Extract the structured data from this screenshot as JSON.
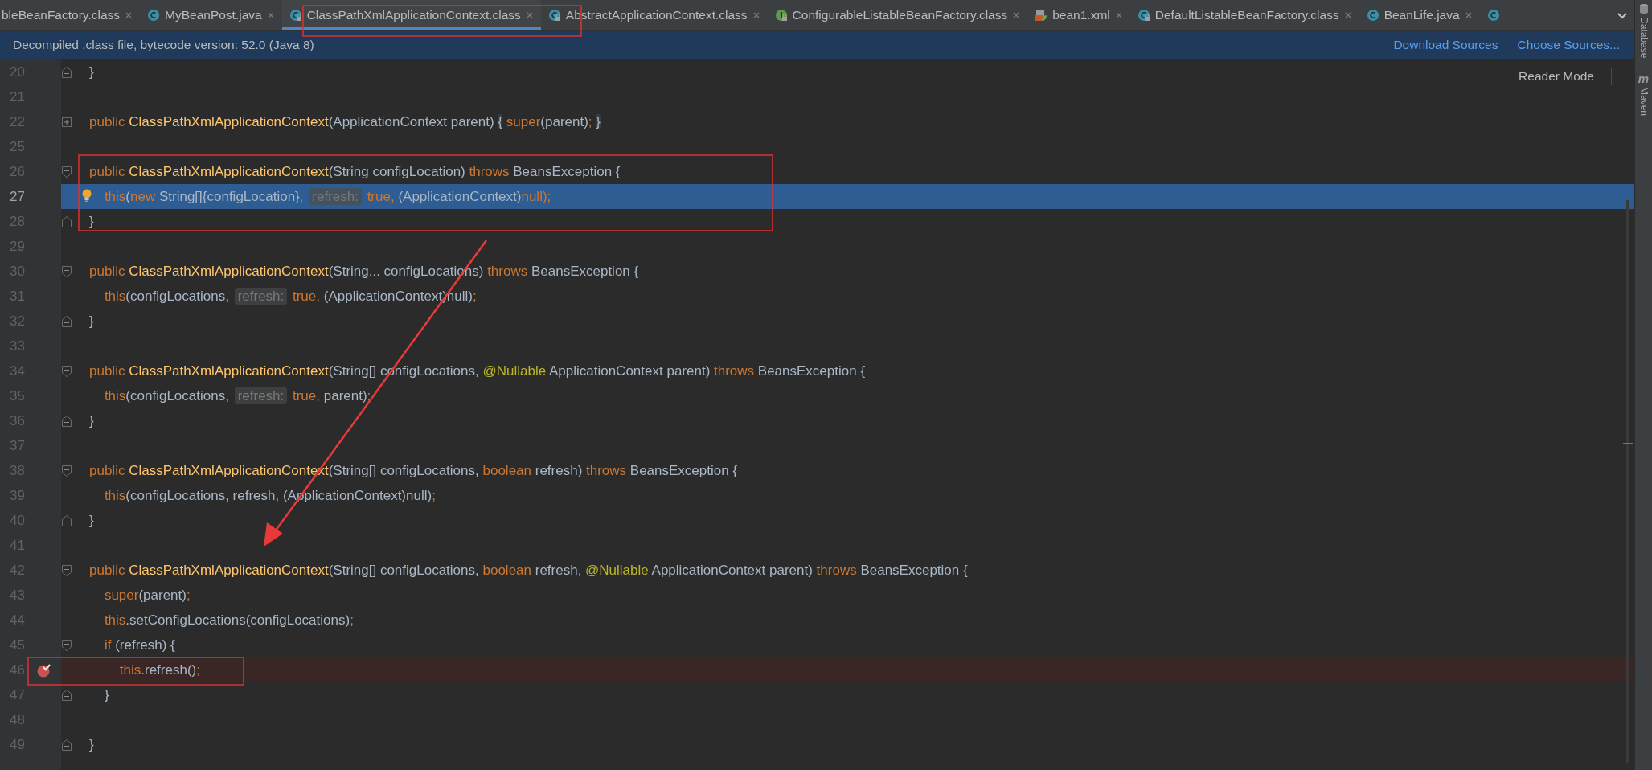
{
  "tabs": [
    {
      "label": "bleBeanFactory.class",
      "kind": "cut",
      "selected": false
    },
    {
      "label": "MyBeanPost.java",
      "kind": "class",
      "selected": false
    },
    {
      "label": "ClassPathXmlApplicationContext.class",
      "kind": "locked-class",
      "selected": true
    },
    {
      "label": "AbstractApplicationContext.class",
      "kind": "locked-class",
      "selected": false
    },
    {
      "label": "ConfigurableListableBeanFactory.class",
      "kind": "locked-interface",
      "selected": false
    },
    {
      "label": "bean1.xml",
      "kind": "xml",
      "selected": false
    },
    {
      "label": "DefaultListableBeanFactory.class",
      "kind": "locked-class",
      "selected": false
    },
    {
      "label": "BeanLife.java",
      "kind": "class",
      "selected": false
    },
    {
      "kind": "class",
      "selected": false
    }
  ],
  "banner": {
    "message": "Decompiled .class file, bytecode version: 52.0 (Java 8)",
    "links": [
      "Download Sources",
      "Choose Sources..."
    ]
  },
  "editor": {
    "reader_mode": "Reader Mode",
    "lines": [
      {
        "number": "20",
        "kind": "block-end",
        "segments": [
          {
            "kind": "plain",
            "t": "}"
          }
        ]
      },
      {
        "number": "21",
        "kind": "plain"
      },
      {
        "number": "22",
        "kind": "folded",
        "segments": [
          {
            "kind": "keyword",
            "t": "public "
          },
          {
            "kind": "name",
            "t": "ClassPathXmlApplicationContext"
          },
          {
            "kind": "plain",
            "t": "(ApplicationContext parent) "
          },
          {
            "kind": "fold",
            "t": "{"
          },
          {
            "kind": "keyword",
            "t": " super"
          },
          {
            "kind": "plain",
            "t": "(parent)"
          },
          {
            "kind": "keyword",
            "t": "; "
          },
          {
            "kind": "fold",
            "t": "}"
          }
        ]
      },
      {
        "number": "25",
        "kind": "plain"
      },
      {
        "number": "26",
        "kind": "block-start",
        "segments": [
          {
            "kind": "keyword",
            "t": "public "
          },
          {
            "kind": "name",
            "t": "ClassPathXmlApplicationContext"
          },
          {
            "kind": "plain",
            "t": "(String configLocation) "
          },
          {
            "kind": "keyword",
            "t": "throws "
          },
          {
            "kind": "plain",
            "t": "BeansException {"
          }
        ]
      },
      {
        "number": "27",
        "kind": "caret",
        "segments": [
          {
            "kind": "keyword",
            "t": "    this"
          },
          {
            "kind": "plain",
            "t": "("
          },
          {
            "kind": "keyword",
            "t": "new "
          },
          {
            "kind": "plain",
            "t": "String[]{configLocation}"
          },
          {
            "kind": "keyword",
            "t": ", "
          },
          {
            "kind": "hint",
            "t": "refresh:"
          },
          {
            "kind": "keyword",
            "t": " true, "
          },
          {
            "kind": "plain",
            "t": "(ApplicationContext)"
          },
          {
            "kind": "keyword",
            "t": "null);"
          }
        ]
      },
      {
        "number": "28",
        "kind": "block-end",
        "segments": [
          {
            "kind": "plain",
            "t": "}"
          }
        ]
      },
      {
        "number": "29",
        "kind": "plain"
      },
      {
        "number": "30",
        "kind": "block-start",
        "segments": [
          {
            "kind": "keyword",
            "t": "public "
          },
          {
            "kind": "name",
            "t": "ClassPathXmlApplicationContext"
          },
          {
            "kind": "plain",
            "t": "(String... configLocations) "
          },
          {
            "kind": "keyword",
            "t": "throws "
          },
          {
            "kind": "plain",
            "t": "BeansException {"
          }
        ]
      },
      {
        "number": "31",
        "kind": "plain",
        "segments": [
          {
            "kind": "keyword",
            "t": "    this"
          },
          {
            "kind": "plain",
            "t": "(configLocations"
          },
          {
            "kind": "keyword",
            "t": ", "
          },
          {
            "kind": "hint",
            "t": "refresh:"
          },
          {
            "kind": "keyword",
            "t": " true, "
          },
          {
            "kind": "plain",
            "t": "(ApplicationContext)null)"
          },
          {
            "kind": "keyword",
            "t": ";"
          }
        ]
      },
      {
        "number": "32",
        "kind": "block-end",
        "segments": [
          {
            "kind": "plain",
            "t": "}"
          }
        ]
      },
      {
        "number": "33",
        "kind": "plain"
      },
      {
        "number": "34",
        "kind": "block-start",
        "segments": [
          {
            "kind": "keyword",
            "t": "public "
          },
          {
            "kind": "name",
            "t": "ClassPathXmlApplicationContext"
          },
          {
            "kind": "plain",
            "t": "(String[] configLocations, "
          },
          {
            "kind": "annotation",
            "t": "@Nullable "
          },
          {
            "kind": "plain",
            "t": "ApplicationContext parent) "
          },
          {
            "kind": "keyword",
            "t": "throws "
          },
          {
            "kind": "plain",
            "t": "BeansException {"
          }
        ]
      },
      {
        "number": "35",
        "kind": "plain",
        "segments": [
          {
            "kind": "keyword",
            "t": "    this"
          },
          {
            "kind": "plain",
            "t": "(configLocations"
          },
          {
            "kind": "keyword",
            "t": ", "
          },
          {
            "kind": "hint",
            "t": "refresh:"
          },
          {
            "kind": "keyword",
            "t": " true, "
          },
          {
            "kind": "plain",
            "t": "parent)"
          },
          {
            "kind": "keyword",
            "t": ";"
          }
        ]
      },
      {
        "number": "36",
        "kind": "block-end",
        "segments": [
          {
            "kind": "plain",
            "t": "}"
          }
        ]
      },
      {
        "number": "37",
        "kind": "plain"
      },
      {
        "number": "38",
        "kind": "block-start",
        "segments": [
          {
            "kind": "keyword",
            "t": "public "
          },
          {
            "kind": "name",
            "t": "ClassPathXmlApplicationContext"
          },
          {
            "kind": "plain",
            "t": "(String[] configLocations, "
          },
          {
            "kind": "keyword",
            "t": "boolean "
          },
          {
            "kind": "plain",
            "t": "refresh) "
          },
          {
            "kind": "keyword",
            "t": "throws "
          },
          {
            "kind": "plain",
            "t": "BeansException {"
          }
        ]
      },
      {
        "number": "39",
        "kind": "plain",
        "segments": [
          {
            "kind": "keyword",
            "t": "    this"
          },
          {
            "kind": "plain",
            "t": "(configLocations, refresh, (ApplicationContext)null)"
          },
          {
            "kind": "keyword",
            "t": ";"
          }
        ]
      },
      {
        "number": "40",
        "kind": "block-end",
        "segments": [
          {
            "kind": "plain",
            "t": "}"
          }
        ]
      },
      {
        "number": "41",
        "kind": "plain"
      },
      {
        "number": "42",
        "kind": "block-start",
        "segments": [
          {
            "kind": "keyword",
            "t": "public "
          },
          {
            "kind": "name",
            "t": "ClassPathXmlApplicationContext"
          },
          {
            "kind": "plain",
            "t": "(String[] configLocations, "
          },
          {
            "kind": "keyword",
            "t": "boolean "
          },
          {
            "kind": "plain",
            "t": "refresh, "
          },
          {
            "kind": "annotation",
            "t": "@Nullable "
          },
          {
            "kind": "plain",
            "t": "ApplicationContext parent) "
          },
          {
            "kind": "keyword",
            "t": "throws "
          },
          {
            "kind": "plain",
            "t": "BeansException {"
          }
        ]
      },
      {
        "number": "43",
        "kind": "plain",
        "segments": [
          {
            "kind": "keyword",
            "t": "    super"
          },
          {
            "kind": "plain",
            "t": "(parent)"
          },
          {
            "kind": "keyword",
            "t": ";"
          }
        ]
      },
      {
        "number": "44",
        "kind": "plain",
        "segments": [
          {
            "kind": "keyword",
            "t": "    this"
          },
          {
            "kind": "plain",
            "t": ".setConfigLocations(configLocations)"
          },
          {
            "kind": "keyword",
            "t": ";"
          }
        ]
      },
      {
        "number": "45",
        "kind": "block-start",
        "segments": [
          {
            "kind": "keyword",
            "t": "    if "
          },
          {
            "kind": "plain",
            "t": "(refresh) {"
          }
        ]
      },
      {
        "number": "46",
        "kind": "breakpoint",
        "segments": [
          {
            "kind": "keyword",
            "t": "        this"
          },
          {
            "kind": "plain",
            "t": ".refresh()"
          },
          {
            "kind": "keyword",
            "t": ";"
          }
        ]
      },
      {
        "number": "47",
        "kind": "block-end",
        "segments": [
          {
            "kind": "plain",
            "t": "    }"
          }
        ]
      },
      {
        "number": "48",
        "kind": "plain"
      },
      {
        "number": "49",
        "kind": "block-end",
        "segments": [
          {
            "kind": "plain",
            "t": "}"
          }
        ]
      }
    ]
  },
  "side_strip": {
    "tools": [
      {
        "kind": "database",
        "label": "Database"
      },
      {
        "kind": "maven",
        "glyph": "m",
        "label": "Maven"
      }
    ]
  }
}
